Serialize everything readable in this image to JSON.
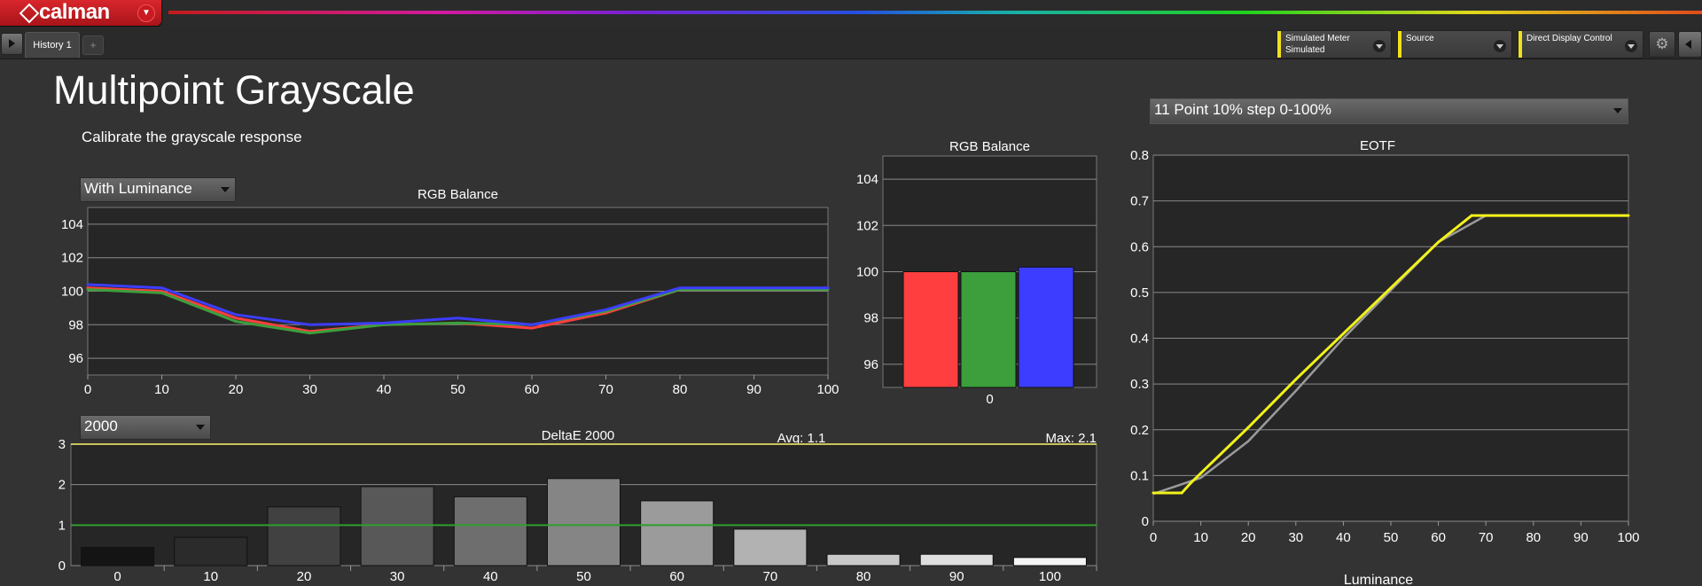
{
  "app": {
    "name": "calman"
  },
  "tabs": [
    {
      "label": "History 1"
    }
  ],
  "add_tab_label": "+",
  "toolbar": {
    "meter": {
      "line1": "Simulated Meter",
      "line2": "Simulated"
    },
    "source": {
      "label": "Source"
    },
    "display": {
      "label": "Direct Display Control"
    }
  },
  "page": {
    "title": "Multipoint Grayscale",
    "subtitle": "Calibrate the grayscale response"
  },
  "controls": {
    "luminance_mode": "With Luminance",
    "deltae_mode": "2000",
    "point_set": "11 Point 10% step 0-100%"
  },
  "colors": {
    "red": "#ff3f3f",
    "green": "#3c9f3c",
    "blue": "#3d3dff",
    "yellow": "#f2f21a",
    "target": "#9a9a9a",
    "threshold": "#2e9e2e"
  },
  "chart_data": [
    {
      "type": "line",
      "title": "RGB Balance",
      "x": [
        0,
        10,
        20,
        30,
        40,
        50,
        60,
        70,
        80,
        90,
        100
      ],
      "series": [
        {
          "values": [
            100.2,
            100.0,
            98.4,
            97.6,
            98.0,
            98.1,
            97.8,
            98.7,
            100.1,
            100.1,
            100.1
          ]
        },
        {
          "values": [
            100.1,
            99.9,
            98.2,
            97.5,
            98.0,
            98.1,
            98.0,
            98.8,
            100.1,
            100.1,
            100.1
          ]
        },
        {
          "values": [
            100.4,
            100.2,
            98.6,
            98.0,
            98.1,
            98.4,
            98.0,
            98.9,
            100.2,
            100.2,
            100.2
          ]
        }
      ],
      "xlim": [
        0,
        100
      ],
      "ylim": [
        95,
        105
      ],
      "yticks": [
        96,
        98,
        100,
        102,
        104
      ],
      "xticks": [
        0,
        10,
        20,
        30,
        40,
        50,
        60,
        70,
        80,
        90,
        100
      ],
      "grid": true
    },
    {
      "type": "bar",
      "title": "RGB Balance",
      "categories": [
        "0"
      ],
      "series": [
        {
          "values": [
            100.0
          ]
        },
        {
          "values": [
            100.0
          ]
        },
        {
          "values": [
            100.2
          ]
        }
      ],
      "ylim": [
        95,
        105
      ],
      "yticks": [
        96,
        98,
        100,
        102,
        104
      ],
      "grid": true
    },
    {
      "type": "bar",
      "title": "DeltaE 2000",
      "avg_label": "Avg: 1.1",
      "max_label": "Max: 2.1",
      "categories": [
        "0",
        "10",
        "20",
        "30",
        "40",
        "50",
        "60",
        "70",
        "80",
        "90",
        "100"
      ],
      "values": [
        0.45,
        0.7,
        1.45,
        1.95,
        1.7,
        2.15,
        1.6,
        0.9,
        0.28,
        0.28,
        0.2
      ],
      "ylim": [
        0,
        3
      ],
      "yticks": [
        0,
        1,
        2,
        3
      ],
      "threshold_lines": [
        1,
        3
      ],
      "grid": true
    },
    {
      "type": "line",
      "title": "EOTF",
      "xlabel": "Luminance",
      "x": [
        0,
        10,
        20,
        30,
        40,
        50,
        60,
        70,
        80,
        90,
        100
      ],
      "series": [
        {
          "values": [
            0.06,
            0.095,
            0.175,
            0.285,
            0.4,
            0.505,
            0.61,
            0.668,
            0.668,
            0.668,
            0.668
          ]
        },
        {
          "x": [
            0,
            6,
            8,
            10,
            20,
            30,
            40,
            50,
            60,
            67,
            70,
            80,
            90,
            100
          ],
          "values": [
            0.062,
            0.062,
            0.085,
            0.105,
            0.205,
            0.31,
            0.41,
            0.51,
            0.61,
            0.668,
            0.668,
            0.668,
            0.668,
            0.668
          ]
        }
      ],
      "xlim": [
        0,
        100
      ],
      "ylim": [
        0,
        0.8
      ],
      "yticks": [
        0,
        0.1,
        0.2,
        0.3,
        0.4,
        0.5,
        0.6,
        0.7,
        0.8
      ],
      "xticks": [
        0,
        10,
        20,
        30,
        40,
        50,
        60,
        70,
        80,
        90,
        100
      ],
      "grid": true
    }
  ]
}
